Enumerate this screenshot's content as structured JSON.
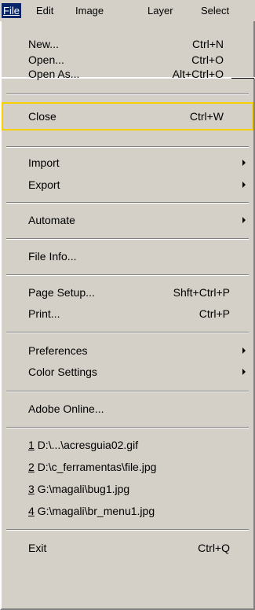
{
  "menubar": {
    "file": "File",
    "edit": "Edit",
    "image": "Image",
    "layer": "Layer",
    "select": "Select"
  },
  "menu": {
    "new": {
      "label": "New...",
      "shortcut": "Ctrl+N"
    },
    "open": {
      "label": "Open...",
      "shortcut": "Ctrl+O"
    },
    "open_as": {
      "label": "Open As...",
      "shortcut": "Alt+Ctrl+O"
    },
    "close": {
      "label": "Close",
      "shortcut": "Ctrl+W"
    },
    "import": {
      "label": "Import"
    },
    "export": {
      "label": "Export"
    },
    "automate": {
      "label": "Automate"
    },
    "file_info": {
      "label": "File Info..."
    },
    "page_setup": {
      "label": "Page Setup...",
      "shortcut": "Shft+Ctrl+P"
    },
    "print": {
      "label": "Print...",
      "shortcut": "Ctrl+P"
    },
    "preferences": {
      "label": "Preferences"
    },
    "color_settings": {
      "label": "Color Settings"
    },
    "adobe_online": {
      "label": "Adobe Online..."
    },
    "recent": [
      {
        "num": "1",
        "path": "D:\\...\\acresguia02.gif"
      },
      {
        "num": "2",
        "path": "D:\\c_ferramentas\\file.jpg"
      },
      {
        "num": "3",
        "path": "G:\\magali\\bug1.jpg"
      },
      {
        "num": "4",
        "path": "G:\\magali\\br_menu1.jpg"
      }
    ],
    "exit": {
      "label": "Exit",
      "shortcut": "Ctrl+Q"
    }
  },
  "colors": {
    "menu_bg": "#d4d0c8",
    "active_bg": "#0a246a",
    "highlight_border": "#f4d000"
  }
}
